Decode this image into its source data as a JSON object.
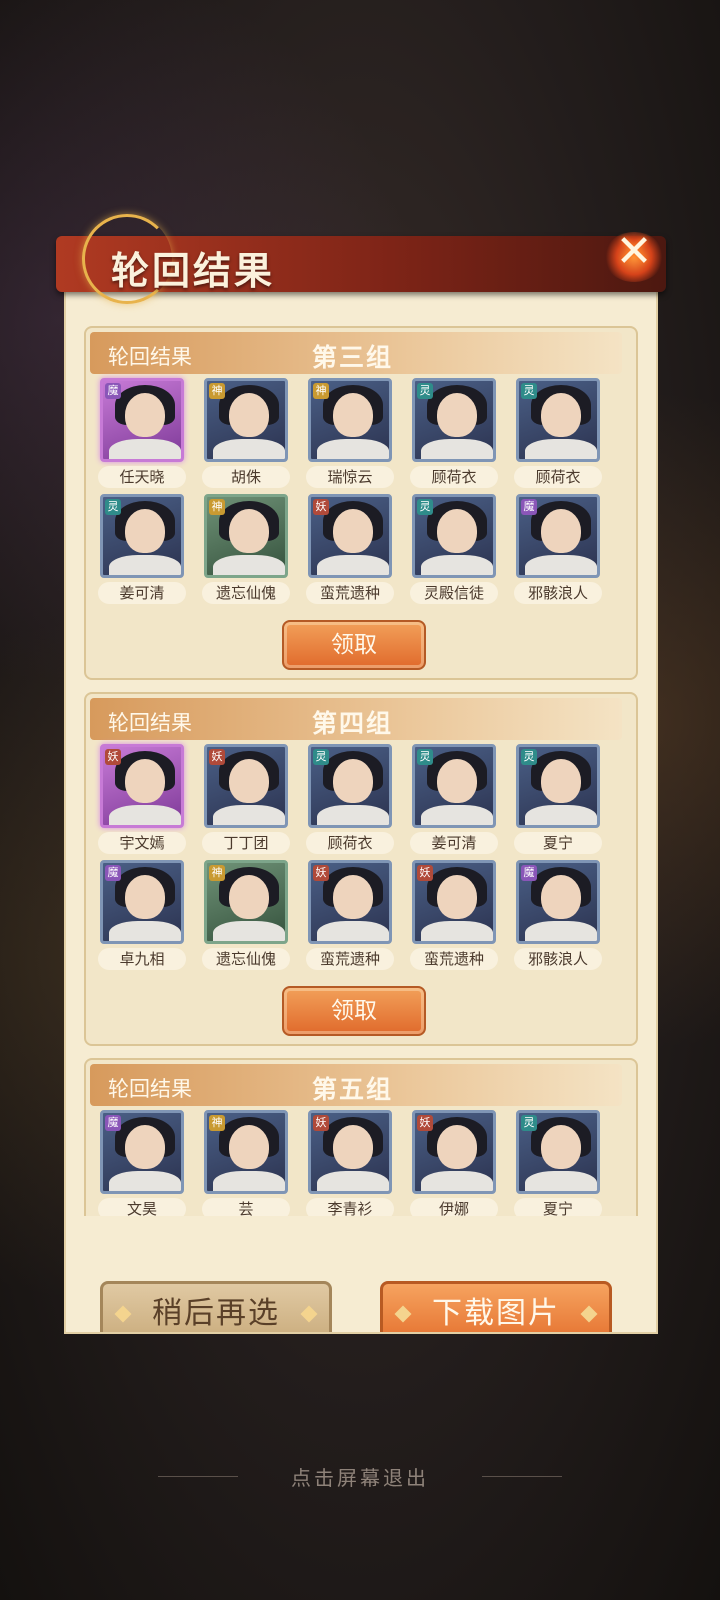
{
  "dialog": {
    "title": "轮回结果",
    "close_icon": "close-icon"
  },
  "groups": [
    {
      "header_label": "轮回结果",
      "group_name": "第三组",
      "claim_label": "领取",
      "characters": [
        {
          "name": "任天晓",
          "badge": "魔"
        },
        {
          "name": "胡侏",
          "badge": "神"
        },
        {
          "name": "瑞惊云",
          "badge": "神"
        },
        {
          "name": "顾荷衣",
          "badge": "灵"
        },
        {
          "name": "顾荷衣",
          "badge": "灵"
        },
        {
          "name": "姜可清",
          "badge": "灵"
        },
        {
          "name": "遗忘仙傀",
          "badge": "神"
        },
        {
          "name": "蛮荒遗种",
          "badge": "妖"
        },
        {
          "name": "灵殿信徒",
          "badge": "灵"
        },
        {
          "name": "邪骸浪人",
          "badge": "魔"
        }
      ]
    },
    {
      "header_label": "轮回结果",
      "group_name": "第四组",
      "claim_label": "领取",
      "characters": [
        {
          "name": "宇文嫣",
          "badge": "妖"
        },
        {
          "name": "丁丁团",
          "badge": "妖"
        },
        {
          "name": "顾荷衣",
          "badge": "灵"
        },
        {
          "name": "姜可清",
          "badge": "灵"
        },
        {
          "name": "夏宁",
          "badge": "灵"
        },
        {
          "name": "卓九相",
          "badge": "魔"
        },
        {
          "name": "遗忘仙傀",
          "badge": "神"
        },
        {
          "name": "蛮荒遗种",
          "badge": "妖"
        },
        {
          "name": "蛮荒遗种",
          "badge": "妖"
        },
        {
          "name": "邪骸浪人",
          "badge": "魔"
        }
      ]
    },
    {
      "header_label": "轮回结果",
      "group_name": "第五组",
      "characters": [
        {
          "name": "文昊",
          "badge": "魔"
        },
        {
          "name": "芸",
          "badge": "神"
        },
        {
          "name": "李青衫",
          "badge": "妖"
        },
        {
          "name": "伊娜",
          "badge": "妖"
        },
        {
          "name": "夏宁",
          "badge": "灵"
        }
      ]
    }
  ],
  "buttons": {
    "later": "稍后再选",
    "download": "下载图片"
  },
  "exit_hint": "点击屏幕退出"
}
